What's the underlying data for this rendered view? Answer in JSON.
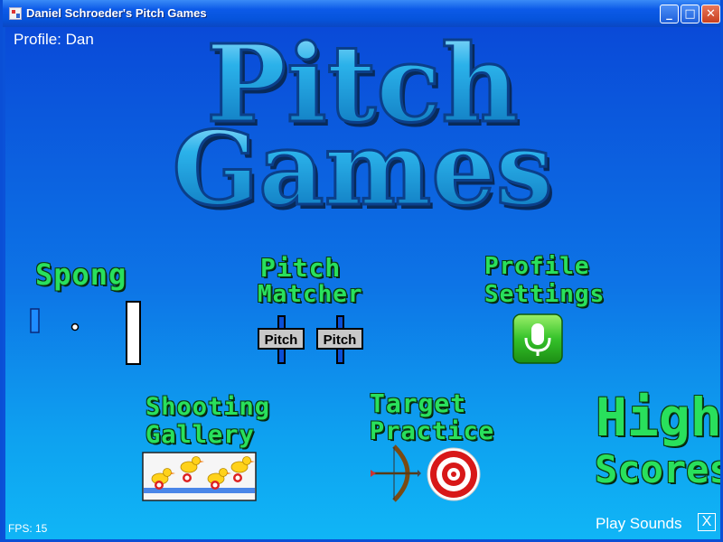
{
  "window": {
    "title": "Daniel Schroeder's Pitch Games",
    "minimize_glyph": "_",
    "maximize_glyph": "□",
    "close_glyph": "✕"
  },
  "profile": {
    "label": "Profile: Dan"
  },
  "logo": {
    "line1": "Pitch",
    "line2": "Games"
  },
  "games": {
    "spong": {
      "title": "Spong"
    },
    "pitch_matcher": {
      "title_line1": "Pitch",
      "title_line2": "Matcher",
      "slider_label_1": "Pitch",
      "slider_label_2": "Pitch"
    },
    "profile_settings": {
      "title_line1": "Profile",
      "title_line2": "Settings",
      "icon": "microphone-icon"
    },
    "shooting_gallery": {
      "title_line1": "Shooting",
      "title_line2": "Gallery"
    },
    "target_practice": {
      "title_line1": "Target",
      "title_line2": "Practice"
    },
    "high_scores": {
      "title_line1": "High",
      "title_line2": "Scores"
    }
  },
  "footer": {
    "fps_text": "FPS: 15",
    "play_sounds_label": "Play Sounds",
    "play_sounds_toggle": "X"
  },
  "colors": {
    "title_bar": "#0654dc",
    "background_top": "#0a4ad8",
    "background_bottom": "#10b6f6",
    "menu_text": "#29e05c",
    "logo_fill": "#1aa6e4",
    "logo_outline": "#0b3f8a"
  }
}
